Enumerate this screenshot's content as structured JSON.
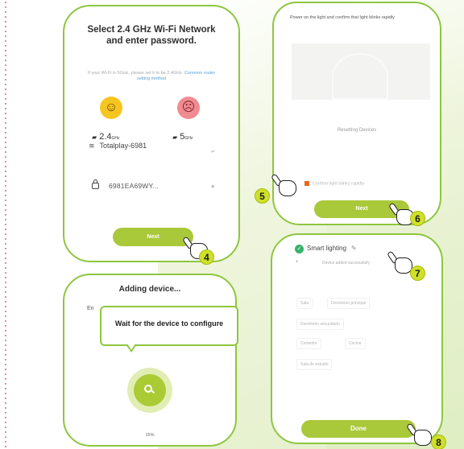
{
  "colors": {
    "accent_green": "#8dc63f",
    "button_green": "#a9c83a",
    "step_yellow": "#cfe02a"
  },
  "panel1": {
    "title": "Select 2.4 GHz Wi-Fi Network and enter password.",
    "hint": "If your Wi-Fi is 5GHz, please set it to be 2.4GHz.",
    "hint_link": "Common router setting method",
    "band_a": "2.4",
    "band_a_unit": "GHz",
    "band_b": "5",
    "band_b_unit": "GHz",
    "ssid": "Totalplay-6981",
    "password": "6981EA69WY...",
    "next_label": "Next",
    "step": "4"
  },
  "panel2": {
    "title": "Adding device...",
    "partial_text": "En",
    "progress_text": "15%"
  },
  "tooltip": {
    "text": "Wait for the device to configure"
  },
  "panel3": {
    "instruction": "Power on the light and confirm that light blinks rapidly",
    "status": "Resetting Devices",
    "confirm_label": "Confirm light blinks rapidly",
    "next_label": "Next",
    "step_confirm": "5",
    "step_next": "6"
  },
  "panel4": {
    "device_name": "Smart lighting",
    "subtitle": "Device added successfully",
    "rooms": [
      "Sala",
      "Dormitorio principal",
      "Dormitorio secundario",
      "Comedor",
      "Cocina",
      "Sala de estudio"
    ],
    "done_label": "Done",
    "step_edit": "7",
    "step_done": "8"
  }
}
